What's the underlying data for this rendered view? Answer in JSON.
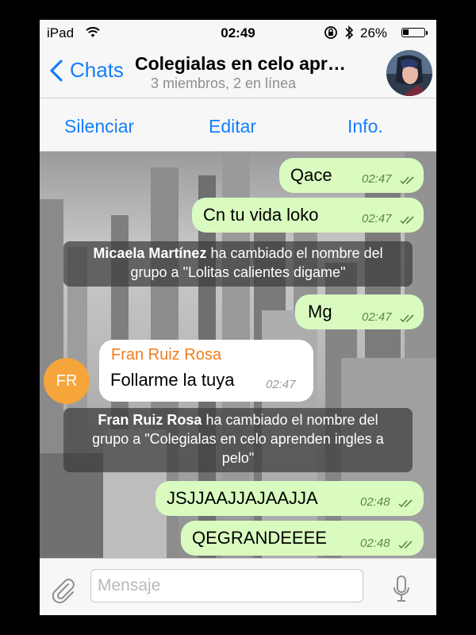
{
  "status_bar": {
    "carrier": "iPad",
    "time": "02:49",
    "battery_percent": "26%",
    "battery_level": 0.26
  },
  "nav": {
    "back_label": "Chats",
    "title": "Colegialas en celo apr…",
    "subtitle": "3 miembros, 2 en línea"
  },
  "actions": {
    "mute": "Silenciar",
    "edit": "Editar",
    "info": "Info."
  },
  "messages": [
    {
      "text": "Qace",
      "time": "02:47"
    },
    {
      "text": "Cn tu vida loko",
      "time": "02:47"
    },
    {
      "text": "Mg",
      "time": "02:47"
    },
    {
      "sender": "Fran Ruiz Rosa",
      "sender_initials": "FR",
      "text": "Follarme la tuya",
      "time": "02:47"
    },
    {
      "text": "JSJJAAJJAJAAJJA",
      "time": "02:48"
    },
    {
      "text": "QEGRANDEEEE",
      "time": "02:48"
    }
  ],
  "system_messages": [
    {
      "actor": "Micaela Martínez",
      "line1_rest": " ha cambiado el nombre del",
      "line2": "grupo a \"Lolitas calientes digame\""
    },
    {
      "actor": "Fran Ruiz Rosa",
      "line1_rest": " ha cambiado el nombre del",
      "line2": "grupo a \"Colegialas en celo aprenden ingles a",
      "line3": "pelo\""
    }
  ],
  "input": {
    "placeholder": "Mensaje"
  },
  "colors": {
    "accent": "#157efb",
    "outgoing_bubble": "#d9fbc0",
    "sender_name": "#f07d1a"
  }
}
